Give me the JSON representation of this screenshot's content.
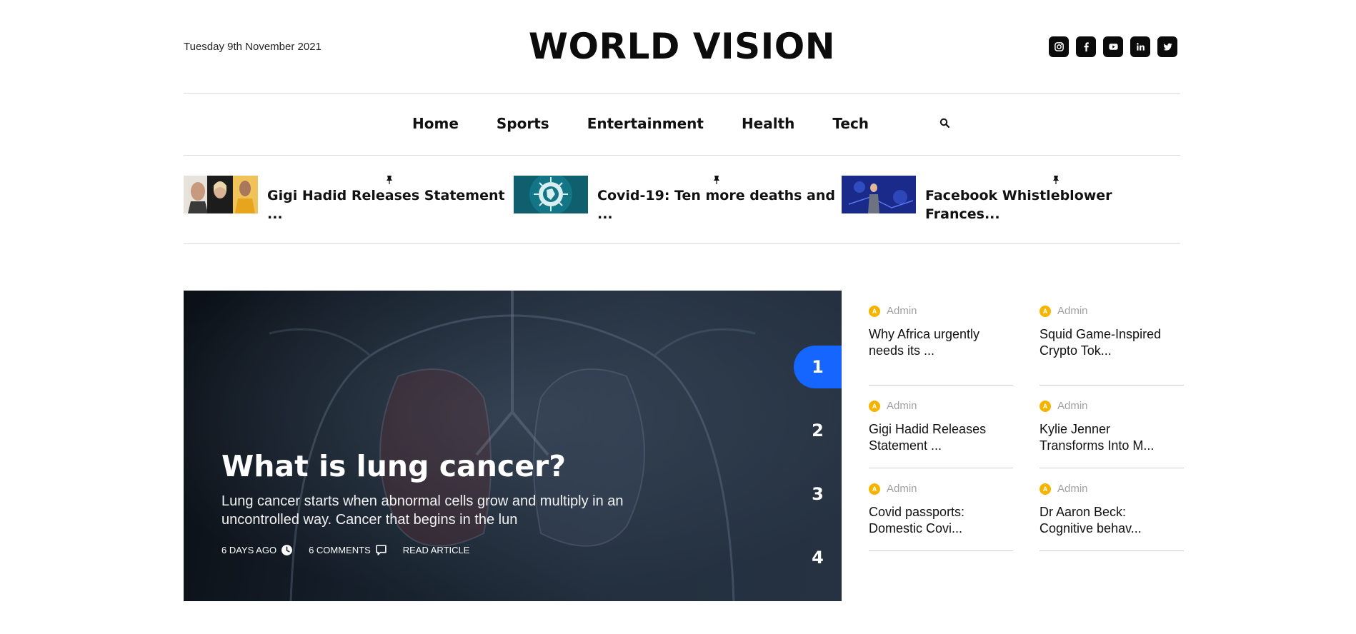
{
  "header": {
    "date": "Tuesday 9th November 2021",
    "site_title": "WORLD VISION",
    "socials": [
      {
        "icon": "instagram-icon"
      },
      {
        "icon": "facebook-icon"
      },
      {
        "icon": "youtube-icon"
      },
      {
        "icon": "linkedin-icon"
      },
      {
        "icon": "twitter-icon"
      }
    ]
  },
  "nav": {
    "items": [
      "Home",
      "Sports",
      "Entertainment",
      "Health",
      "Tech"
    ],
    "search_icon": "search-icon"
  },
  "ticker": [
    {
      "line1": "Gigi Hadid Releases Statement",
      "line2": "..."
    },
    {
      "line1": "Covid-19: Ten more deaths and",
      "line2": "..."
    },
    {
      "line1": "Facebook Whistleblower",
      "line2": "Frances..."
    }
  ],
  "hero": {
    "title": "What is lung cancer?",
    "excerpt_line1": "Lung cancer starts when abnormal cells grow and multiply in an",
    "excerpt_line2": "uncontrolled way. Cancer that begins in the lun",
    "time": "6 DAYS AGO",
    "comments": "6 COMMENTS",
    "read": "READ ARTICLE",
    "slides": [
      "1",
      "2",
      "3",
      "4"
    ],
    "active_slide": "1",
    "accent": "#1565ff"
  },
  "side": [
    {
      "author": "Admin",
      "avatar": "A",
      "line1": "Why Africa urgently",
      "line2": "needs its ..."
    },
    {
      "author": "Admin",
      "avatar": "A",
      "line1": "Squid Game-Inspired",
      "line2": "Crypto Tok..."
    },
    {
      "author": "Admin",
      "avatar": "A",
      "line1": "Gigi Hadid Releases",
      "line2": "Statement ..."
    },
    {
      "author": "Admin",
      "avatar": "A",
      "line1": "Kylie Jenner",
      "line2": "Transforms Into M..."
    },
    {
      "author": "Admin",
      "avatar": "A",
      "line1": "Covid passports:",
      "line2": "Domestic Covi..."
    },
    {
      "author": "Admin",
      "avatar": "A",
      "line1": "Dr Aaron Beck:",
      "line2": "Cognitive behav..."
    }
  ]
}
